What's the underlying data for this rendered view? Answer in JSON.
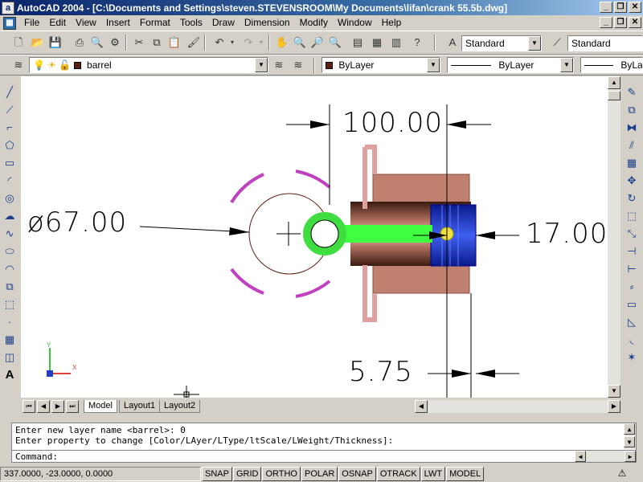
{
  "window": {
    "title": "AutoCAD 2004 - [C:\\Documents and Settings\\steven.STEVENSROOM\\My Documents\\lifan\\crank 55.5b.dwg]",
    "app_icon": "a"
  },
  "menu": {
    "items": [
      "File",
      "Edit",
      "View",
      "Insert",
      "Format",
      "Tools",
      "Draw",
      "Dimension",
      "Modify",
      "Window",
      "Help"
    ]
  },
  "toolbar": {
    "text_style": "Standard",
    "dim_style": "Standard"
  },
  "layers": {
    "current_layer": "barrel",
    "color": "ByLayer",
    "linetype": "ByLayer",
    "lineweight": "ByLay"
  },
  "drawing": {
    "dim_top": "100.00",
    "dim_left": "ø67.00",
    "dim_right": "17.00",
    "dim_bottom": "5.75",
    "ucs_x": "X",
    "ucs_y": "Y"
  },
  "tabs": {
    "model": "Model",
    "layout1": "Layout1",
    "layout2": "Layout2"
  },
  "command": {
    "line1": "Enter new layer name <barrel>: 0",
    "line2": "Enter property to change [Color/LAyer/LType/ltScale/LWeight/Thickness]:",
    "prompt": "Command:"
  },
  "status": {
    "coords": "337.0000, -23.0000, 0.0000",
    "buttons": [
      "SNAP",
      "GRID",
      "ORTHO",
      "POLAR",
      "OSNAP",
      "OTRACK",
      "LWT",
      "MODEL"
    ]
  }
}
